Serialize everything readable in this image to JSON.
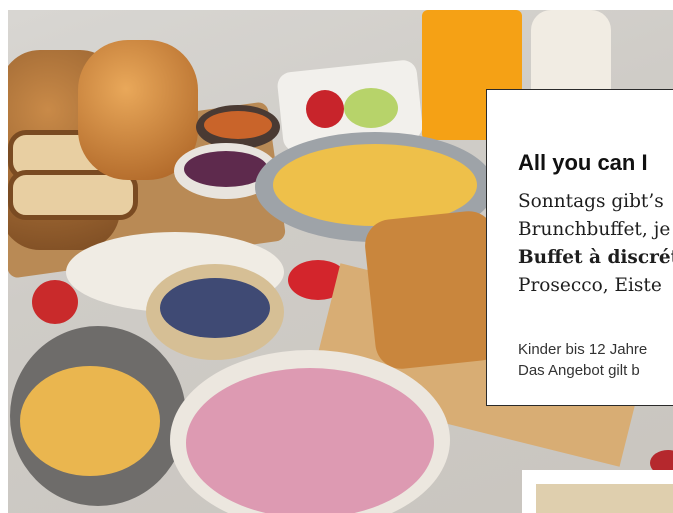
{
  "card": {
    "title": "All you can I",
    "body_lines": [
      "Sonntags gibt’s",
      "Brunchbuffet, je",
      "Buffet à discrét",
      "Prosecco, Eiste"
    ],
    "note_lines": [
      "Kinder bis 12 Jahre",
      "Das Angebot gilt b"
    ]
  },
  "photo": {
    "subject": "breakfast-brunch-buffet"
  }
}
